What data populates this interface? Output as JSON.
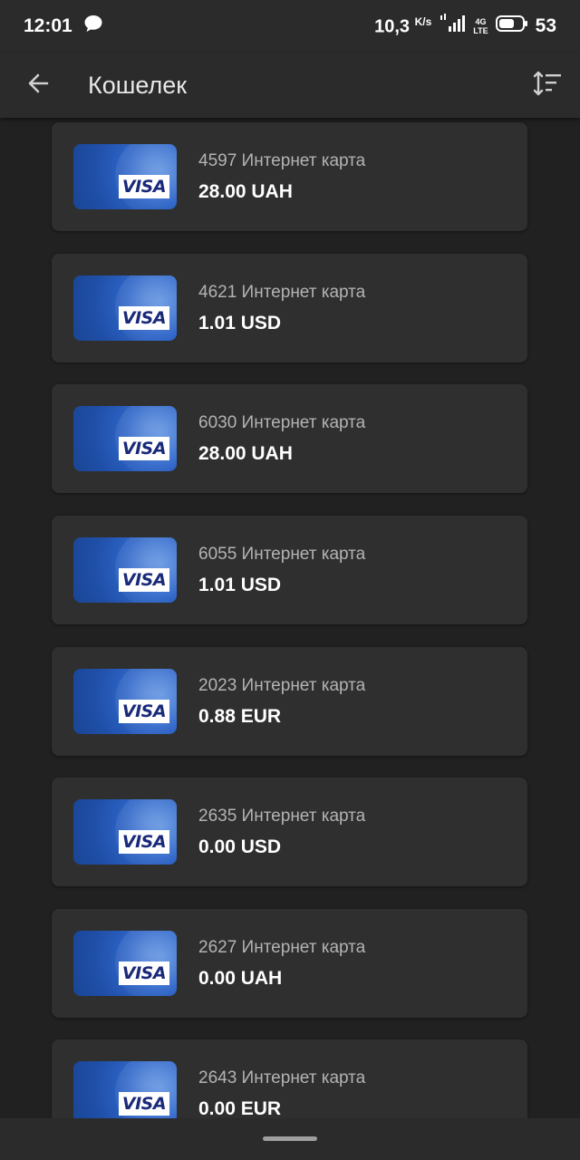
{
  "status_bar": {
    "time": "12:01",
    "message_icon": "chat-bubble-icon",
    "speed": "10,3",
    "speed_unit": "K/s",
    "network": "4G LTE",
    "battery": "53"
  },
  "app_bar": {
    "back_icon": "arrow-left-icon",
    "title": "Кошелек",
    "sort_icon": "sort-icon"
  },
  "cards": [
    {
      "name": "4597 Интернет карта",
      "amount": "28.00 UAH",
      "brand": "VISA"
    },
    {
      "name": "4621 Интернет карта",
      "amount": "1.01 USD",
      "brand": "VISA"
    },
    {
      "name": "6030 Интернет карта",
      "amount": "28.00 UAH",
      "brand": "VISA"
    },
    {
      "name": "6055 Интернет карта",
      "amount": "1.01 USD",
      "brand": "VISA"
    },
    {
      "name": "2023 Интернет карта",
      "amount": "0.88 EUR",
      "brand": "VISA"
    },
    {
      "name": "2635 Интернет карта",
      "amount": "0.00 USD",
      "brand": "VISA"
    },
    {
      "name": "2627 Интернет карта",
      "amount": "0.00 UAH",
      "brand": "VISA"
    },
    {
      "name": "2643 Интернет карта",
      "amount": "0.00 EUR",
      "brand": "VISA"
    }
  ],
  "colors": {
    "background": "#212121",
    "card_background": "#2f2f2f",
    "bar_background": "#2b2b2b",
    "visa_blue": "#2f66c9"
  }
}
